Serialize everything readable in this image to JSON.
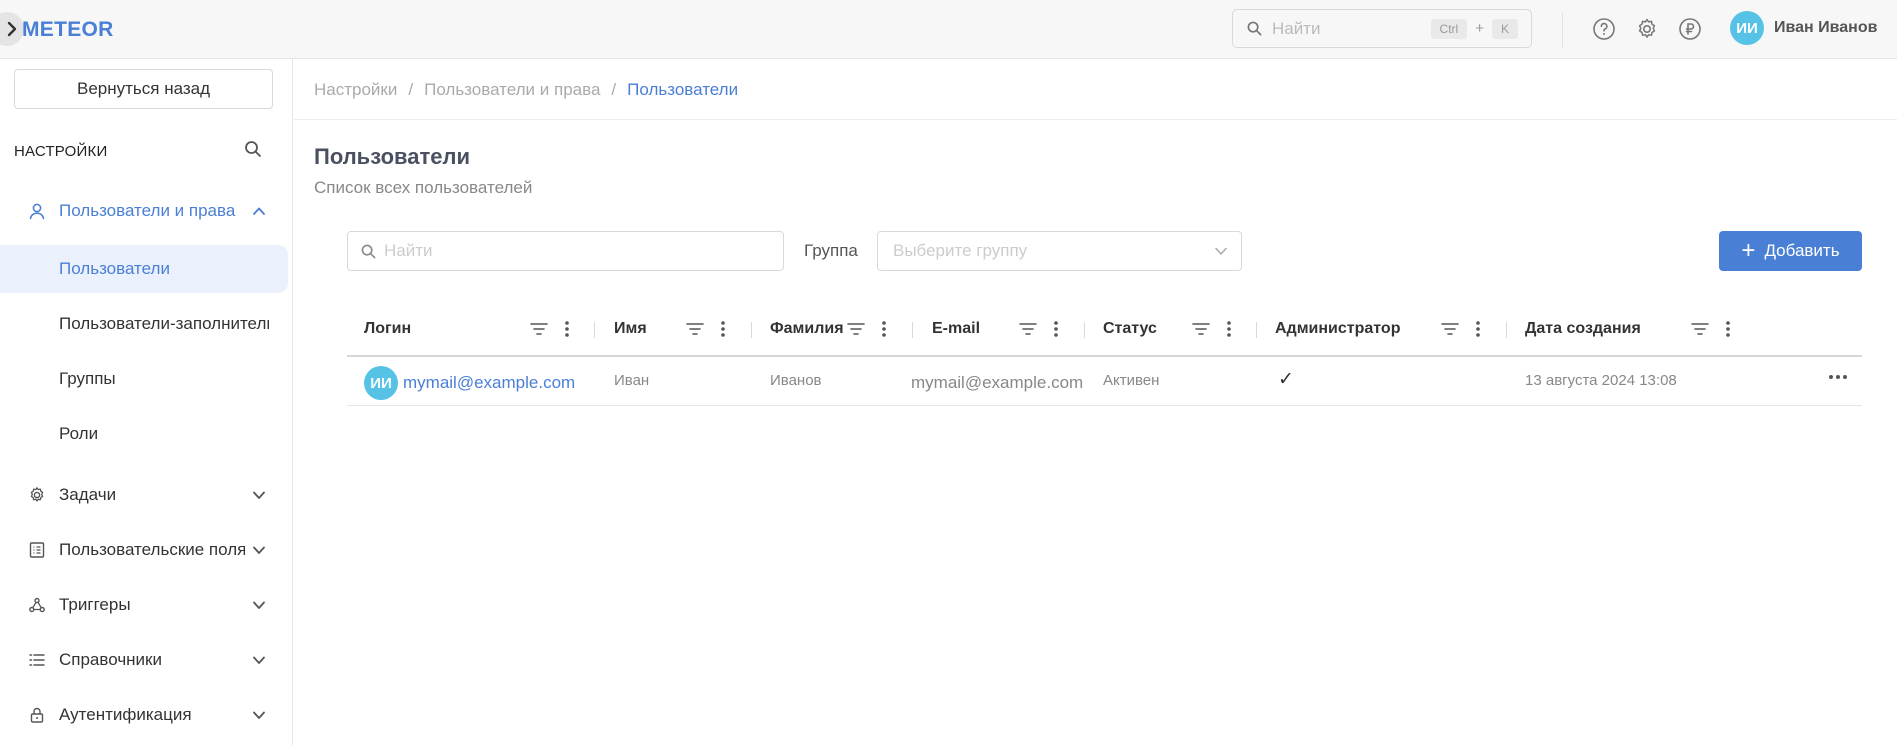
{
  "app": {
    "logo": "METEOR",
    "search": {
      "placeholder": "Найти",
      "kbd1": "Ctrl",
      "kbd_plus": "+",
      "kbd2": "K"
    },
    "icons": [
      "help-icon",
      "gear-icon",
      "ruble-icon"
    ],
    "user": {
      "initials": "ИИ",
      "name": "Иван Иванов"
    },
    "colors": {
      "accent": "#4a7fd6",
      "avatar": "#56c2e6"
    }
  },
  "sidebar": {
    "back_label": "Вернуться назад",
    "header": "НАСТРОЙКИ",
    "users_rights": {
      "label": "Пользователи и права",
      "children": [
        {
          "label": "Пользователи"
        },
        {
          "label": "Пользователи-заполнители"
        },
        {
          "label": "Группы"
        },
        {
          "label": "Роли"
        }
      ]
    },
    "items": [
      {
        "label": "Задачи"
      },
      {
        "label": "Пользовательские поля"
      },
      {
        "label": "Триггеры"
      },
      {
        "label": "Справочники"
      },
      {
        "label": "Аутентификация"
      }
    ]
  },
  "breadcrumb": [
    "Настройки",
    "Пользователи и права",
    "Пользователи"
  ],
  "breadcrumb_sep": "/",
  "page": {
    "title": "Пользователи",
    "subtitle": "Список всех пользователей",
    "search_placeholder": "Найти",
    "group_label": "Группа",
    "group_placeholder": "Выберите группу",
    "add_label": "Добавить",
    "add_symbol": "+"
  },
  "table": {
    "columns": [
      "Логин",
      "Имя",
      "Фамилия",
      "E-mail",
      "Статус",
      "Администратор",
      "Дата создания"
    ],
    "rows": [
      {
        "initials": "ИИ",
        "login": "mymail@example.com",
        "first_name": "Иван",
        "last_name": "Иванов",
        "email": "mymail@example.com",
        "status": "Активен",
        "admin": "✓",
        "created": "13 августа 2024 13:08"
      }
    ]
  }
}
